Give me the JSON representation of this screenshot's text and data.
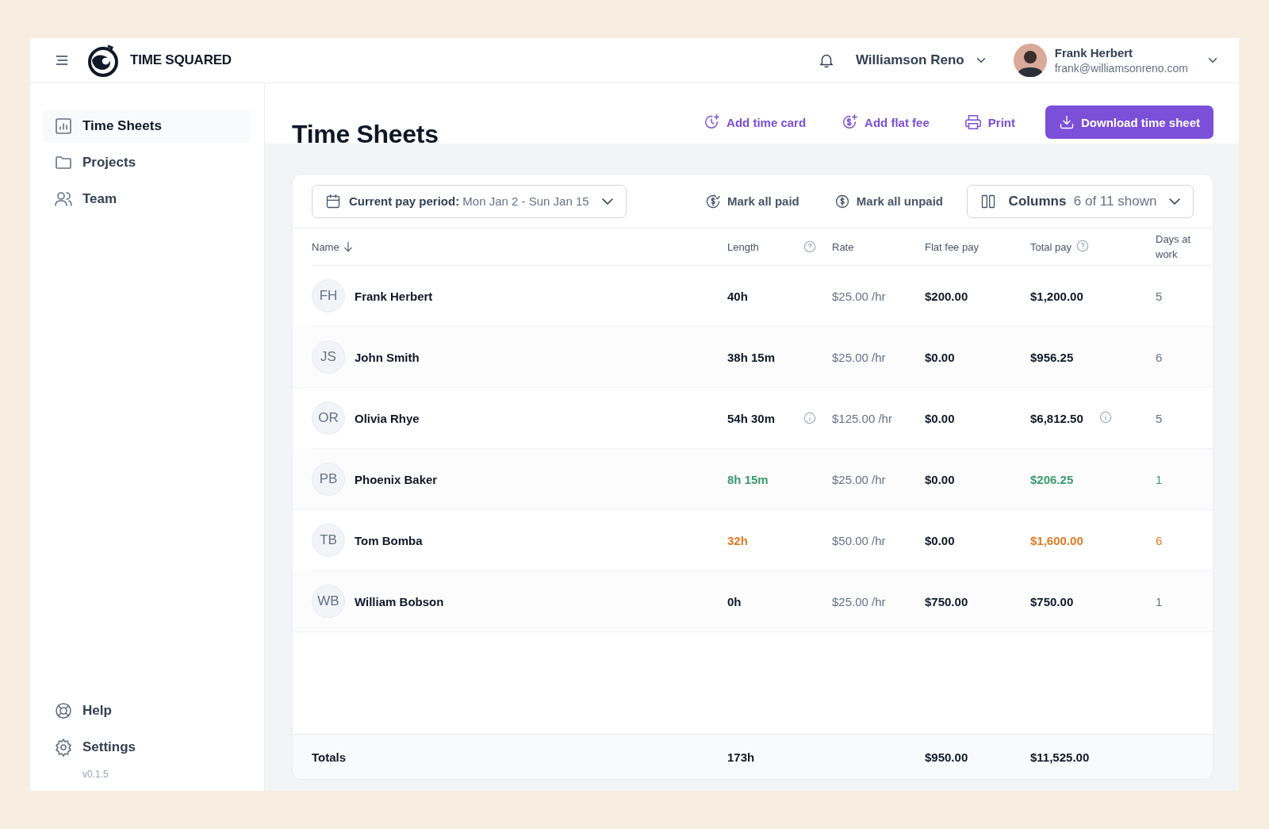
{
  "header": {
    "brand": "TIME SQUARED",
    "workspace": "Williamson Reno",
    "user": {
      "name": "Frank Herbert",
      "email": "frank@williamsonreno.com"
    }
  },
  "sidebar": {
    "items": [
      {
        "label": "Time Sheets",
        "selected": true
      },
      {
        "label": "Projects",
        "selected": false
      },
      {
        "label": "Team",
        "selected": false
      }
    ],
    "footer_items": [
      {
        "label": "Help"
      },
      {
        "label": "Settings"
      }
    ],
    "version": "v0.1.5"
  },
  "page": {
    "title": "Time Sheets",
    "actions": [
      {
        "label": "Add time card",
        "kind": "link"
      },
      {
        "label": "Add flat fee",
        "kind": "link"
      },
      {
        "label": "Print",
        "kind": "link"
      },
      {
        "label": "Download time sheet",
        "kind": "primary"
      }
    ]
  },
  "toolbar": {
    "period_label": "Current pay period:",
    "period_value": "Mon Jan 2 - Sun Jan 15",
    "mark_paid": "Mark all paid",
    "mark_unpaid": "Mark all unpaid",
    "columns_label": "Columns",
    "columns_count": "6 of 11 shown"
  },
  "table": {
    "columns": [
      {
        "label": "Name",
        "sorted": true,
        "help": false
      },
      {
        "label": "Length",
        "sorted": false,
        "help": true
      },
      {
        "label": "Rate",
        "sorted": false,
        "help": false
      },
      {
        "label": "Flat fee pay",
        "sorted": false,
        "help": false
      },
      {
        "label": "Total pay",
        "sorted": false,
        "help": true
      },
      {
        "label": "Days at work",
        "sorted": false,
        "help": false
      }
    ],
    "rows": [
      {
        "initials": "FH",
        "name": "Frank Herbert",
        "length": "40h",
        "length_info": false,
        "rate": "$25.00 /hr",
        "flat_fee": "$200.00",
        "total": "$1,200.00",
        "total_info": false,
        "days": "5"
      },
      {
        "initials": "JS",
        "name": "John Smith",
        "length": "38h 15m",
        "length_info": false,
        "rate": "$25.00 /hr",
        "flat_fee": "$0.00",
        "total": "$956.25",
        "total_info": false,
        "days": "6"
      },
      {
        "initials": "OR",
        "name": "Olivia Rhye",
        "length": "54h 30m",
        "length_info": true,
        "rate": "$125.00 /hr",
        "flat_fee": "$0.00",
        "total": "$6,812.50",
        "total_info": true,
        "days": "5"
      },
      {
        "initials": "PB",
        "name": "Phoenix Baker",
        "length": "8h 15m",
        "length_info": false,
        "rate": "$25.00 /hr",
        "flat_fee": "$0.00",
        "total": "$206.25",
        "total_info": false,
        "days": "1",
        "color": "#3a9a6c"
      },
      {
        "initials": "TB",
        "name": "Tom Bomba",
        "length": "32h",
        "length_info": false,
        "rate": "$50.00 /hr",
        "flat_fee": "$0.00",
        "total": "$1,600.00",
        "total_info": false,
        "days": "6",
        "color": "#e07a24"
      },
      {
        "initials": "WB",
        "name": "William Bobson",
        "length": "0h",
        "length_info": false,
        "rate": "$25.00 /hr",
        "flat_fee": "$750.00",
        "total": "$750.00",
        "total_info": false,
        "days": "1"
      }
    ],
    "totals": {
      "label": "Totals",
      "length": "173h",
      "flat_fee": "$950.00",
      "total": "$11,525.00"
    }
  }
}
